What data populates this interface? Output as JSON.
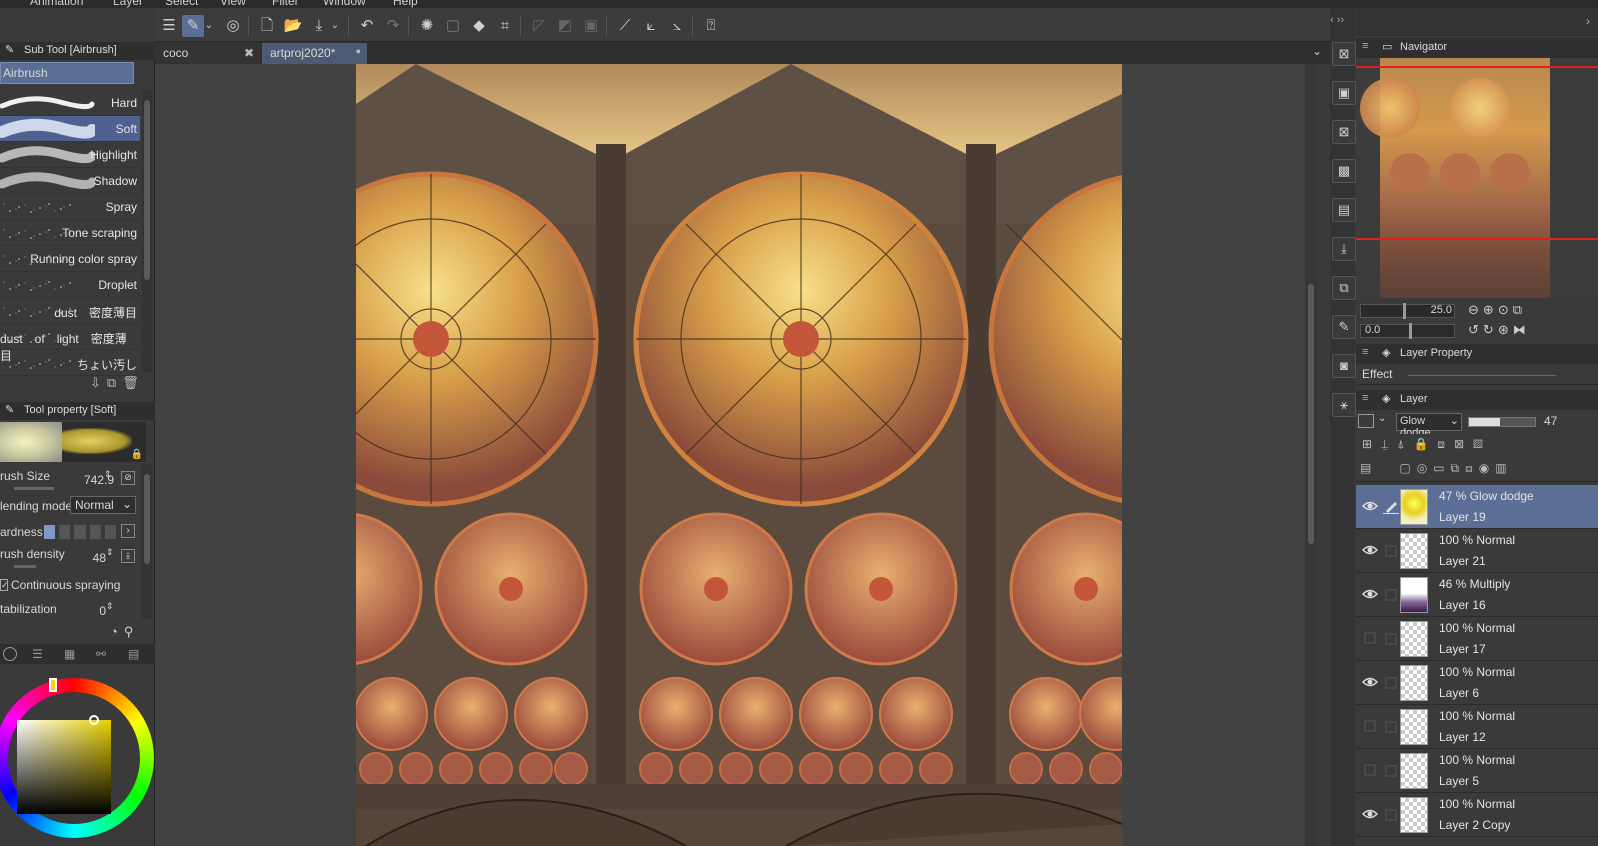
{
  "menu": {
    "animation": "Animation",
    "layer": "Layer",
    "select": "Select",
    "view": "View",
    "filter": "Filter",
    "window": "Window",
    "help": "Help"
  },
  "tabs": [
    {
      "label": "coco",
      "close": "✖"
    },
    {
      "label": "artproj2020*",
      "close": "●"
    }
  ],
  "subtool": {
    "header": "Sub Tool [Airbrush]",
    "group": "Airbrush",
    "brushes": [
      {
        "label": "Hard"
      },
      {
        "label": "Soft"
      },
      {
        "label": "Highlight"
      },
      {
        "label": "Shadow"
      },
      {
        "label": "Spray"
      },
      {
        "label": "Tone scraping"
      },
      {
        "label": "Running color spray"
      },
      {
        "label": "Droplet"
      },
      {
        "label": "dust　密度薄目"
      },
      {
        "label": "dust　of　light　密度薄目"
      },
      {
        "label": "ちょい汚し"
      }
    ]
  },
  "toolprop": {
    "header": "Tool property [Soft]",
    "brush_size_label": "rush Size",
    "brush_size_value": "742.9",
    "blending_label": "lending mode",
    "blending_value": "Normal",
    "hardness_label": "ardness",
    "density_label": "rush density",
    "density_value": "48",
    "continuous_label": "Continuous spraying",
    "stabilization_label": "tabilization",
    "stabilization_value": "0"
  },
  "navigator": {
    "header": "Navigator",
    "zoom": "25.0",
    "rotation": "0.0"
  },
  "layer_property": {
    "header": "Layer Property",
    "effect": "Effect"
  },
  "layer_panel": {
    "header": "Layer",
    "blend_mode": "Glow dodge",
    "opacity": "47"
  },
  "layers": [
    {
      "mode": "47 % Glow dodge",
      "name": "Layer 19",
      "visible": true,
      "selected": true
    },
    {
      "mode": "100 % Normal",
      "name": "Layer 21",
      "visible": true,
      "selected": false
    },
    {
      "mode": "46 % Multiply",
      "name": "Layer 16",
      "visible": true,
      "selected": false
    },
    {
      "mode": "100 % Normal",
      "name": "Layer 17",
      "visible": false,
      "selected": false
    },
    {
      "mode": "100 % Normal",
      "name": "Layer 6",
      "visible": true,
      "selected": false
    },
    {
      "mode": "100 % Normal",
      "name": "Layer 12",
      "visible": false,
      "selected": false
    },
    {
      "mode": "100 % Normal",
      "name": "Layer 5",
      "visible": false,
      "selected": false
    },
    {
      "mode": "100 % Normal",
      "name": "Layer 2 Copy",
      "visible": true,
      "selected": false
    }
  ],
  "colors": {
    "accent": "#5a6e96",
    "panel": "#3a3a3a",
    "canvas_bg": "#424242"
  }
}
